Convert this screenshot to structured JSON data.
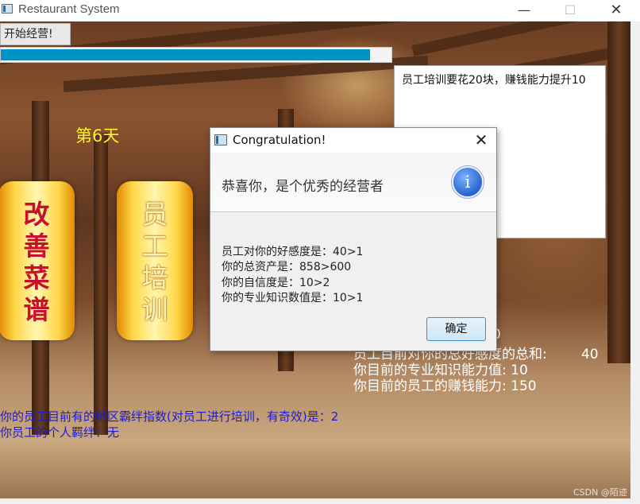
{
  "window": {
    "title": "Restaurant System",
    "minimize_glyph": "—",
    "maximize_glyph": "☐",
    "close_glyph": "✕"
  },
  "toolbar": {
    "start_label": "开始经营!"
  },
  "progress": {
    "value": 0.945,
    "color": "#0094c6"
  },
  "info_panel": {
    "text": "员工培训要花20块，赚钱能力提升10"
  },
  "day_label": "第6天",
  "buttons": {
    "improve_menu": {
      "label": "改善菜谱"
    },
    "train_staff": {
      "label": "员工培训"
    }
  },
  "stats": {
    "line1": "0",
    "line2": "员工目前对你的总好感度的总和:        40",
    "line3": "你目前的专业知识能力值: 10",
    "line4": "你目前的员工的赚钱能力: 150"
  },
  "staff_info": {
    "line1": "你的员工目前有的地区霸绊指数(对员工进行培训，有奇效)是：2",
    "line2": "你员工的个人羁绊：无"
  },
  "dialog": {
    "title": "Congratulation!",
    "close_glyph": "✕",
    "header": "恭喜你，是个优秀的经营者",
    "info_icon_glyph": "i",
    "lines": [
      "员工对你的好感度是：40>1",
      "你的总资产是：858>600",
      "你的自信度是：10>2",
      "你的专业知识数值是：10>1"
    ],
    "ok_label": "确定"
  },
  "watermark": "CSDN @陌迹"
}
